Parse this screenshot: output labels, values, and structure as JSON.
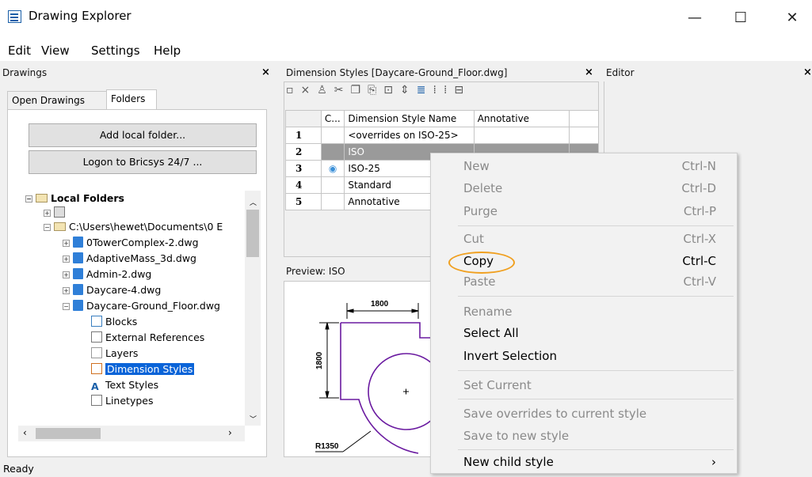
{
  "window": {
    "title": "Drawing Explorer",
    "minimize": "—",
    "maximize": "☐",
    "close": "✕"
  },
  "menus": [
    "Edit",
    "View",
    "Settings",
    "Help"
  ],
  "drawings_panel": {
    "title": "Drawings",
    "close": "×",
    "tabs": [
      "Open Drawings",
      "Folders"
    ],
    "add_folder": "Add local folder...",
    "logon": "Logon to Bricsys 24/7 ...",
    "tree": {
      "root": "Local Folders",
      "folder1": "C:\\Users\\hewet\\Documents\\0 E",
      "folder2": "C:\\Users\\hewet\\Documents\\0 E",
      "files": [
        "0TowerComplex-2.dwg",
        "AdaptiveMass_3d.dwg",
        "Admin-2.dwg",
        "Daycare-4.dwg",
        "Daycare-Ground_Floor.dwg"
      ],
      "children": [
        "Blocks",
        "External References",
        "Layers",
        "Dimension Styles",
        "Text Styles",
        "Linetypes"
      ]
    }
  },
  "dimstyles_panel": {
    "title": "Dimension Styles [Daycare-Ground_Floor.dwg]",
    "close": "×",
    "columns": [
      "C...",
      "Dimension Style Name",
      "Annotative"
    ],
    "rows": [
      {
        "num": "1",
        "name": "<overrides on ISO-25>",
        "current": false
      },
      {
        "num": "2",
        "name": "ISO",
        "current": false
      },
      {
        "num": "3",
        "name": "ISO-25",
        "current": true
      },
      {
        "num": "4",
        "name": "Standard",
        "current": false
      },
      {
        "num": "5",
        "name": "Annotative",
        "current": false
      }
    ]
  },
  "editor_panel": {
    "title": "Editor",
    "close": "×"
  },
  "preview_panel": {
    "title": "Preview: ISO",
    "dim_top": "1800",
    "dim_left": "1800",
    "dim_radius": "R1350"
  },
  "context_menu": [
    {
      "label": "New",
      "shortcut": "Ctrl-N",
      "enabled": false
    },
    {
      "label": "Delete",
      "shortcut": "Ctrl-D",
      "enabled": false
    },
    {
      "label": "Purge",
      "shortcut": "Ctrl-P",
      "enabled": false
    },
    {
      "label": "Cut",
      "shortcut": "Ctrl-X",
      "enabled": false
    },
    {
      "label": "Copy",
      "shortcut": "Ctrl-C",
      "enabled": true
    },
    {
      "label": "Paste",
      "shortcut": "Ctrl-V",
      "enabled": false
    },
    {
      "label": "Rename",
      "shortcut": "",
      "enabled": false
    },
    {
      "label": "Select All",
      "shortcut": "",
      "enabled": true
    },
    {
      "label": "Invert Selection",
      "shortcut": "",
      "enabled": true
    },
    {
      "label": "Set Current",
      "shortcut": "",
      "enabled": false
    },
    {
      "label": "Save overrides to current style",
      "shortcut": "",
      "enabled": false
    },
    {
      "label": "Save to new style",
      "shortcut": "",
      "enabled": false
    },
    {
      "label": "New child style",
      "shortcut": "›",
      "enabled": true
    }
  ],
  "status": {
    "text": "Ready"
  },
  "colors": {
    "highlight_ring": "#f0a020",
    "selection": "#0a64d8",
    "disabled_text": "#8a8a8a"
  }
}
